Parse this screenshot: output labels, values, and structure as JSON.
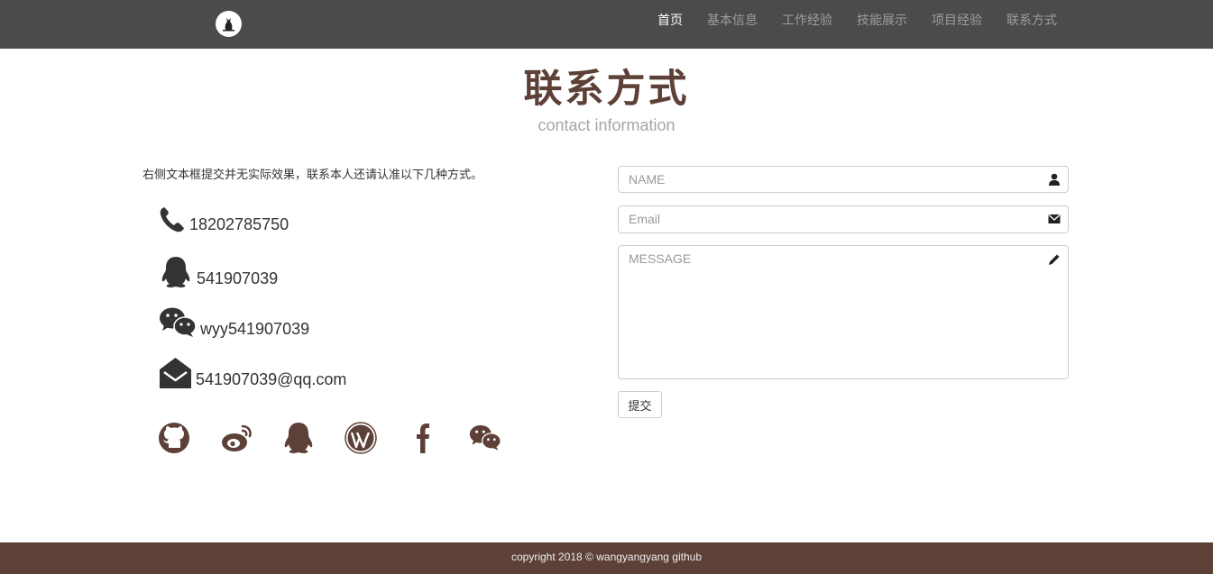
{
  "nav": {
    "items": [
      {
        "label": "首页",
        "active": true
      },
      {
        "label": "基本信息",
        "active": false
      },
      {
        "label": "工作经验",
        "active": false
      },
      {
        "label": "技能展示",
        "active": false
      },
      {
        "label": "项目经验",
        "active": false
      },
      {
        "label": "联系方式",
        "active": false
      }
    ]
  },
  "header": {
    "title": "联系方式",
    "subtitle": "contact information"
  },
  "notice": "右侧文本框提交并无实际效果，联系本人还请认准以下几种方式。",
  "contacts": {
    "phone": "18202785750",
    "qq": "541907039",
    "wechat": "wyy541907039",
    "email": "541907039@qq.com"
  },
  "social_icons": [
    "github-icon",
    "weibo-icon",
    "qq-icon",
    "wordpress-icon",
    "facebook-icon",
    "wechat-icon"
  ],
  "form": {
    "name_placeholder": "NAME",
    "email_placeholder": "Email",
    "message_placeholder": "MESSAGE",
    "submit_label": "提交"
  },
  "footer": {
    "text": "copyright 2018 © wangyangyang github"
  },
  "colors": {
    "navbar": "#4b4b4b",
    "accent": "#5d4037",
    "footer": "#5d4037",
    "subtitle": "#a6a6a6"
  }
}
